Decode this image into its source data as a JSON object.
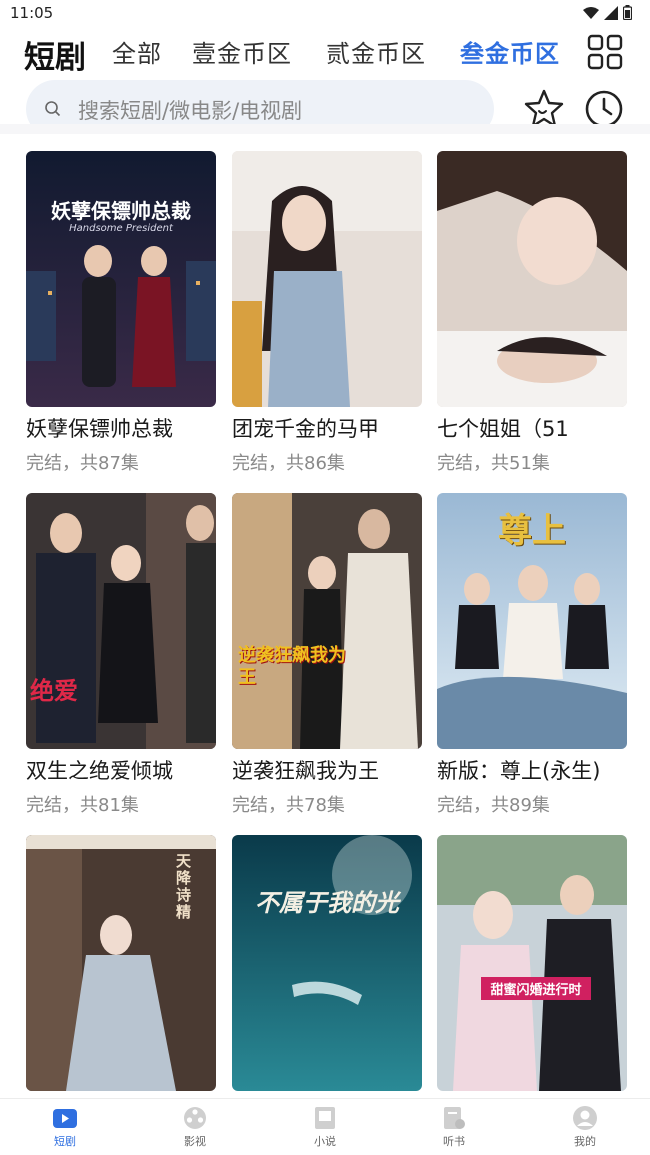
{
  "status": {
    "time": "11:05"
  },
  "categories": [
    {
      "label": "短剧"
    },
    {
      "label": "全部"
    },
    {
      "label": "壹金币区"
    },
    {
      "label": "贰金币区"
    },
    {
      "label": "叁金币区"
    }
  ],
  "search": {
    "placeholder": "搜索短剧/微电影/电视剧"
  },
  "dramas": [
    {
      "title": "妖孽保镖帅总裁",
      "meta": "完结，共87集",
      "poster_text": "妖孽保镖帅总裁",
      "poster_sub": "Handsome President",
      "colors": [
        "#1b2440",
        "#3a2a48"
      ]
    },
    {
      "title": "团宠千金的马甲",
      "meta": "完结，共86集",
      "poster_text": "",
      "poster_sub": "",
      "colors": [
        "#c9b7a5",
        "#e8e0d8"
      ]
    },
    {
      "title": "七个姐姐（51",
      "meta": "完结，共51集",
      "poster_text": "",
      "poster_sub": "",
      "colors": [
        "#d8ccc4",
        "#a89890"
      ]
    },
    {
      "title": "双生之绝爱倾城",
      "meta": "完结，共81集",
      "poster_text": "绝爱",
      "poster_sub": "",
      "colors": [
        "#2a2a30",
        "#6a5a52"
      ]
    },
    {
      "title": "逆袭狂飙我为王",
      "meta": "完结，共78集",
      "poster_text": "逆袭狂飙我为王",
      "poster_sub": "",
      "colors": [
        "#3a3430",
        "#b89a80"
      ]
    },
    {
      "title": "新版：尊上(永生)",
      "meta": "完结，共89集",
      "poster_text": "尊上",
      "poster_sub": "",
      "colors": [
        "#7a9ab8",
        "#d8e6f0"
      ]
    },
    {
      "title": "",
      "meta": "",
      "poster_text": "天降诗精",
      "poster_sub": "",
      "colors": [
        "#4a3a32",
        "#8a7a6a"
      ]
    },
    {
      "title": "",
      "meta": "",
      "poster_text": "不属于我的光",
      "poster_sub": "",
      "colors": [
        "#0e4a5a",
        "#2a8a96"
      ]
    },
    {
      "title": "",
      "meta": "",
      "poster_text": "甜蜜闪婚进行时",
      "poster_sub": "",
      "colors": [
        "#cfd6dc",
        "#8a9aa0"
      ]
    }
  ],
  "tabs": [
    {
      "label": "短剧",
      "icon": "tv-icon",
      "active": true
    },
    {
      "label": "影视",
      "icon": "film-reel-icon",
      "active": false
    },
    {
      "label": "小说",
      "icon": "book-icon",
      "active": false
    },
    {
      "label": "听书",
      "icon": "headphones-book-icon",
      "active": false
    },
    {
      "label": "我的",
      "icon": "profile-icon",
      "active": false
    }
  ],
  "colors": {
    "accent": "#2f6fe0",
    "search_bg": "#eef2f8"
  }
}
